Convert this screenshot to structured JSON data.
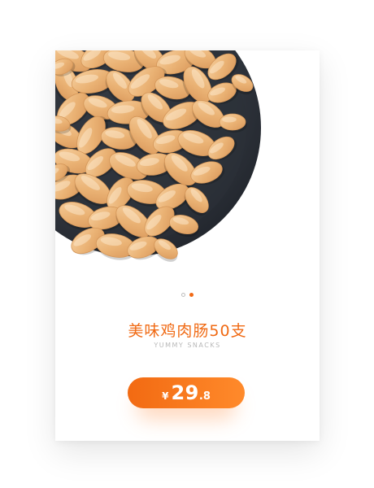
{
  "product": {
    "title": "美味鸡肉肠50支",
    "subtitle": "YUMMY SNACKS",
    "image_icon": "sausage-plate-photo"
  },
  "pagination": {
    "total": 2,
    "current": 2
  },
  "price": {
    "currency": "¥",
    "integer": "29",
    "decimal": ".8"
  },
  "colors": {
    "accent": "#f16a16",
    "plate": "#2f343c",
    "sausage": "#e8ae72"
  }
}
